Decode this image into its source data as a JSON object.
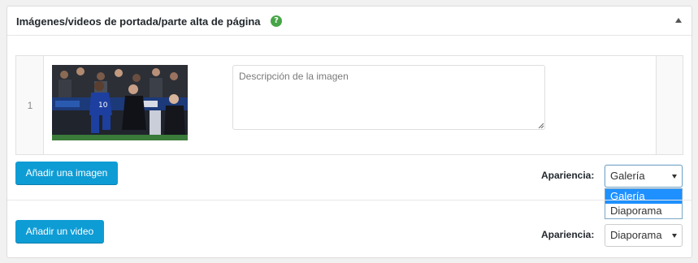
{
  "panel": {
    "title": "Imágenes/videos de portada/parte alta de página",
    "help_icon_glyph": "?",
    "help_icon": "help-circle-icon",
    "collapse_icon": "triangle-up-icon"
  },
  "images": {
    "rows": [
      {
        "index": "1",
        "description_placeholder": "Descripción de la imagen",
        "description_value": ""
      }
    ],
    "add_button_label": "Añadir una imagen",
    "appearance_label": "Apariencia:",
    "appearance_selected": "Galería",
    "appearance_options": [
      "Galería",
      "Diaporama"
    ],
    "dropdown_open": true
  },
  "videos": {
    "add_button_label": "Añadir un video",
    "appearance_label": "Apariencia:",
    "appearance_selected": "Diaporama"
  },
  "colors": {
    "accent": "#0e9cd5",
    "help_icon": "#46a546",
    "option_highlight": "#1e90ff"
  }
}
